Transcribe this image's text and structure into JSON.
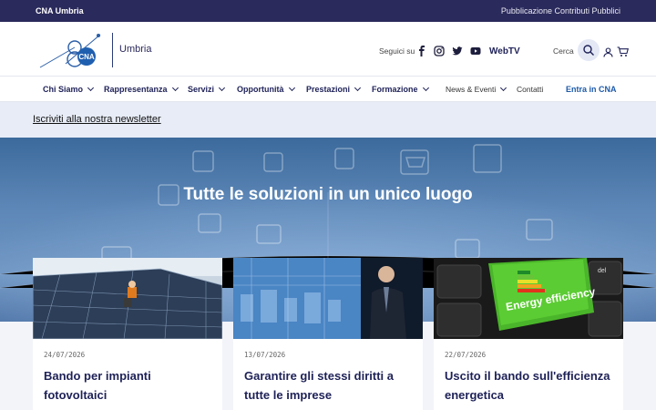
{
  "topbar": {
    "brand": "CNA Umbria",
    "publication_link": "Pubblicazione Contributi Pubblici"
  },
  "header": {
    "logo_text": "CNA",
    "region": "Umbria",
    "follow_label": "Seguici su",
    "social_icons": [
      "facebook-icon",
      "instagram-icon",
      "twitter-icon",
      "youtube-icon"
    ],
    "webtv": "WebTV",
    "search_label": "Cerca"
  },
  "nav": {
    "items": [
      {
        "label": "Chi Siamo",
        "dropdown": true
      },
      {
        "label": "Rappresentanza",
        "dropdown": true
      },
      {
        "label": "Servizi",
        "dropdown": true
      },
      {
        "label": "Opportunità",
        "dropdown": true
      },
      {
        "label": "Prestazioni",
        "dropdown": true
      },
      {
        "label": "Formazione",
        "dropdown": true
      },
      {
        "label": "News & Eventi",
        "dropdown": true
      },
      {
        "label": "Contatti",
        "dropdown": false
      },
      {
        "label": "Entra in CNA",
        "dropdown": false
      }
    ]
  },
  "newsletter": {
    "label": "Iscriviti alla nostra newsletter"
  },
  "hero": {
    "title": "Tutte le soluzioni in un unico luogo"
  },
  "cards": [
    {
      "date": "24/07/2026",
      "title": "Bando per impianti fotovoltaici"
    },
    {
      "date": "13/07/2026",
      "title": "Garantire gli stessi diritti a tutte le imprese"
    },
    {
      "date": "22/07/2026",
      "title": "Uscito il bando sull'efficienza energetica",
      "image_text": "Energy efficiency"
    }
  ],
  "colors": {
    "topbar": "#2b2a5c",
    "nav_text": "#1e2157",
    "newsletter_bg": "#e7ecf6",
    "accent": "#1d5aa8"
  }
}
